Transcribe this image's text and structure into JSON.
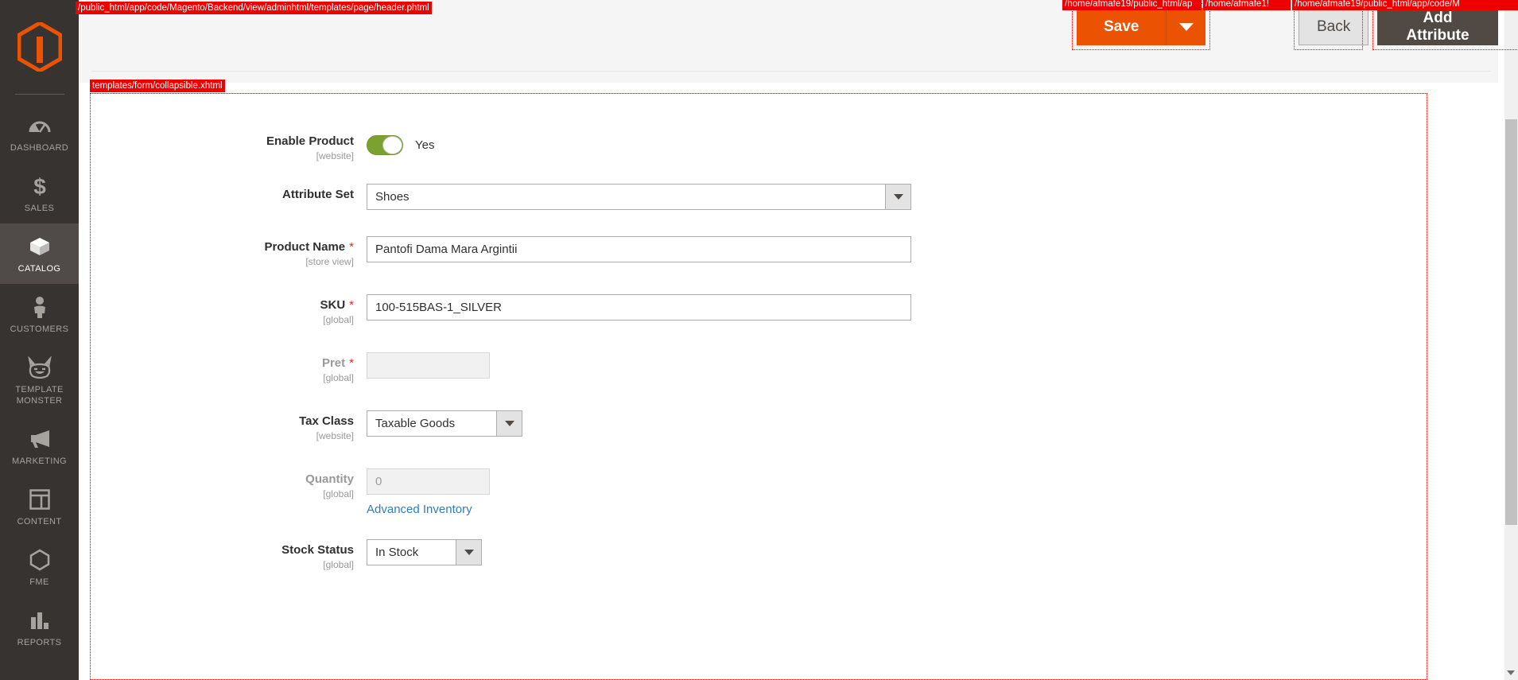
{
  "annotations": {
    "header_template": "/public_html/app/code/Magento/Backend/view/adminhtml/templates/page/header.phtml",
    "save_template": "/home/afmafe19/public_html/ap",
    "back_template": "/home/afmafe1!",
    "addattr_template": "/home/afmafe19/public_html/app/code/M",
    "form_template": "templates/form/collapsible.xhtml"
  },
  "sidebar": {
    "logo_name": "magento-logo",
    "items": [
      {
        "label": "DASHBOARD",
        "icon": "dashboard-icon",
        "active": false
      },
      {
        "label": "SALES",
        "icon": "dollar-icon",
        "active": false
      },
      {
        "label": "CATALOG",
        "icon": "box-icon",
        "active": true
      },
      {
        "label": "CUSTOMERS",
        "icon": "person-icon",
        "active": false
      },
      {
        "label": "TEMPLATE MONSTER",
        "icon": "monster-cat-icon",
        "active": false
      },
      {
        "label": "MARKETING",
        "icon": "megaphone-icon",
        "active": false
      },
      {
        "label": "CONTENT",
        "icon": "layout-icon",
        "active": false
      },
      {
        "label": "FME",
        "icon": "hexagon-icon",
        "active": false
      },
      {
        "label": "REPORTS",
        "icon": "bar-chart-icon",
        "active": false
      }
    ]
  },
  "header": {
    "save_label": "Save",
    "save_caret_icon": "chevron-down-icon",
    "back_label": "Back",
    "add_attribute_label": "Add Attribute"
  },
  "form": {
    "enable_product": {
      "label": "Enable Product",
      "scope": "[website]",
      "value": "Yes",
      "toggle_on": true
    },
    "attribute_set": {
      "label": "Attribute Set",
      "scope": "",
      "value": "Shoes"
    },
    "product_name": {
      "label": "Product Name",
      "scope": "[store view]",
      "required": true,
      "value": "Pantofi Dama Mara Argintii"
    },
    "sku": {
      "label": "SKU",
      "scope": "[global]",
      "required": true,
      "value": "100-515BAS-1_SILVER"
    },
    "pret": {
      "label": "Pret",
      "scope": "[global]",
      "required": true,
      "value": "",
      "disabled": true
    },
    "tax_class": {
      "label": "Tax Class",
      "scope": "[website]",
      "value": "Taxable Goods"
    },
    "quantity": {
      "label": "Quantity",
      "scope": "[global]",
      "value": "0",
      "disabled": true,
      "advanced_inventory_label": "Advanced Inventory"
    },
    "stock_status": {
      "label": "Stock Status",
      "scope": "[global]",
      "value": "In Stock"
    }
  },
  "colors": {
    "sidebar_bg": "#373330",
    "sidebar_active": "#504b48",
    "save_orange": "#eb5202",
    "add_attribute_dark": "#514943",
    "toggle_green": "#79a22e",
    "link_blue": "#2e7ebd",
    "annotation_red": "#ee0000",
    "required_star": "#e22626"
  }
}
